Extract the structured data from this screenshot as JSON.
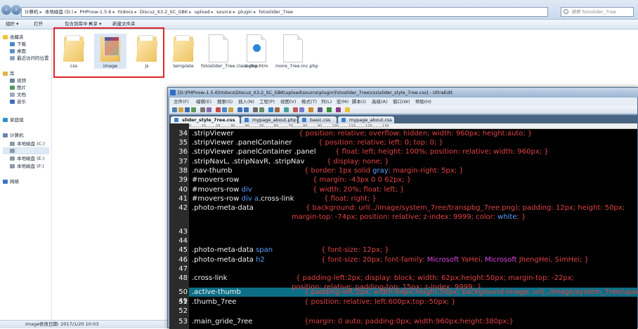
{
  "explorer": {
    "address": [
      "计算机",
      "本地磁盘 (D:)",
      "PHPnow-1.5.6",
      "htdocs",
      "Discuz_X3.2_SC_GBK",
      "upload",
      "source",
      "plugin",
      "fotoslider_7ree"
    ],
    "search_placeholder": "搜索 fotoslider_7ree",
    "toolbar": {
      "organize": "组织 ▾",
      "open": "打开",
      "include": "包含到库中 ▾",
      "share": "共享 ▾",
      "newfolder": "新建文件夹"
    },
    "nav": {
      "favorites": "收藏夹",
      "downloads": "下载",
      "desktop": "桌面",
      "recent": "最近访问的位置",
      "libraries": "库",
      "videos": "视频",
      "pictures": "图片",
      "documents": "文档",
      "music": "音乐",
      "homegroup": "家庭组",
      "computer": "计算机",
      "drive_c": "本地磁盘 (C:)",
      "drive_d": "本地磁盘 (D:)",
      "drive_e": "本地磁盘 (E:)",
      "drive_f": "本地磁盘 (F:)",
      "network": "网络"
    },
    "files": [
      "css",
      "image",
      "js",
      "template",
      "fotoslider_7ree.class.php",
      "index.htm",
      "more_7ree.inc.php"
    ],
    "status": {
      "name": "image",
      "modified": "修改日期: 2017/1/20 10:03"
    }
  },
  "ultraedit": {
    "title": "[D:\\PHPnow-1.5.6\\htdocs\\Discuz_X3.2_SC_GBK\\upload\\source\\plugin\\fotoslider_7ree\\css\\slider_style_7ree.css] - UltraEdit",
    "menu": [
      "文件(F)",
      "编辑(E)",
      "搜索(S)",
      "插入(N)",
      "工程(P)",
      "视图(V)",
      "格式(T)",
      "列(L)",
      "宏(M)",
      "脚本(i)",
      "高级(A)",
      "窗口(W)",
      "帮助(H)"
    ],
    "tabs": [
      "slider_style_7ree.css",
      "mypage_about.php",
      "basic.css",
      "mypage_about.css"
    ],
    "ruler": "0,,,,,,,,,10,,,,,,,,,20,,,,,,,,,30,,,,,,,,,40,,,,,,,,,50,,,,,,,,,60,,,,,,,,,70,,,,,,,,,80,,,,,,,,,90,,,,,,,,,100,,,,,,,,,110,,,,,,,,,120,,,,,,,,,130",
    "lines": [
      {
        "n": "34",
        "sel": ".stripViewer",
        "decl": "{ position: relative; overflow: hidden; width: 960px; height:auto; }"
      },
      {
        "n": "35",
        "sel": ".stripViewer .panelContainer",
        "decl": "{ position: relative; left: 0; top: 0; }"
      },
      {
        "n": "36",
        "sel": ".stripViewer .panelContainer .panel",
        "decl": "{ float: left; height: 100%; position: relative; width: 960px; }"
      },
      {
        "n": "37",
        "sel": ".stripNavL, .stripNavR, .stripNav",
        "decl": "{ display: none; }"
      },
      {
        "n": "38",
        "sel": ".nav-thumb",
        "decl_a": "{ border: 1px solid ",
        "decl_kw": "gray",
        "decl_b": "; margin-right: 5px; }"
      },
      {
        "n": "39",
        "sel": "#movers-row",
        "decl": "{ margin: -43px 0 0 62px; }"
      },
      {
        "n": "40",
        "sel_a": "#movers-row ",
        "sel_kw": "div",
        "decl": "{ width: 20%; float: left; }"
      },
      {
        "n": "41",
        "sel_a": "#movers-row ",
        "sel_kw": "div a",
        "sel_b": ".cross-link",
        "decl": "{ float: right; }"
      },
      {
        "n": "42",
        "sel": ".photo-meta-data",
        "decl": "{ background: url(../image/system_7ree/transpbg_7ree.png); padding: 12px; height: 50px;",
        "cont_a": "margin-top: -74px; position: relative; z-index: 9999; color: ",
        "cont_kw": "white",
        "cont_b": "; }"
      },
      {
        "n": "43"
      },
      {
        "n": "44"
      },
      {
        "n": "45",
        "sel_a": ".photo-meta-data ",
        "sel_kw": "span",
        "decl": "{ font-size: 12px; }"
      },
      {
        "n": "46",
        "sel_a": ".photo-meta-data ",
        "sel_kw": "h2",
        "decl_a": "{ font-size: 20px; font-family: ",
        "decl_m1": "Microsoft",
        "decl_m": " YaHei, ",
        "decl_m2": "Microsoft",
        "decl_b": " JhengHei, SimHei; }"
      },
      {
        "n": "47"
      },
      {
        "n": "48",
        "sel": ".cross-link",
        "decl": "{ padding-left:2px; display: block; width: 62px;height:50px; margin-top: -22px;",
        "cont": "position: relative; padding-top: 15px; z-index: 9999; }"
      },
      {
        "n": "49"
      },
      {
        "n": "50",
        "sel": ".active-thumb",
        "decl": "{ padding-left:2px; width:64px;height:50px; background-image: url(../image/system_7ree/uparrow_icon"
      },
      {
        "n": "51",
        "sel": ".thumb_7ree",
        "decl": "{ position: relative; left:600px;top:-50px; }"
      },
      {
        "n": "52"
      },
      {
        "n": "53",
        "sel": ".main_gride_7ree",
        "decl": "{margin: 0 auto; padding:0px; width:960px;height:380px;}"
      }
    ]
  },
  "colors": {
    "highlight": "#0d6f86",
    "code_bg": "#000000",
    "redbox": "#e0242c"
  }
}
